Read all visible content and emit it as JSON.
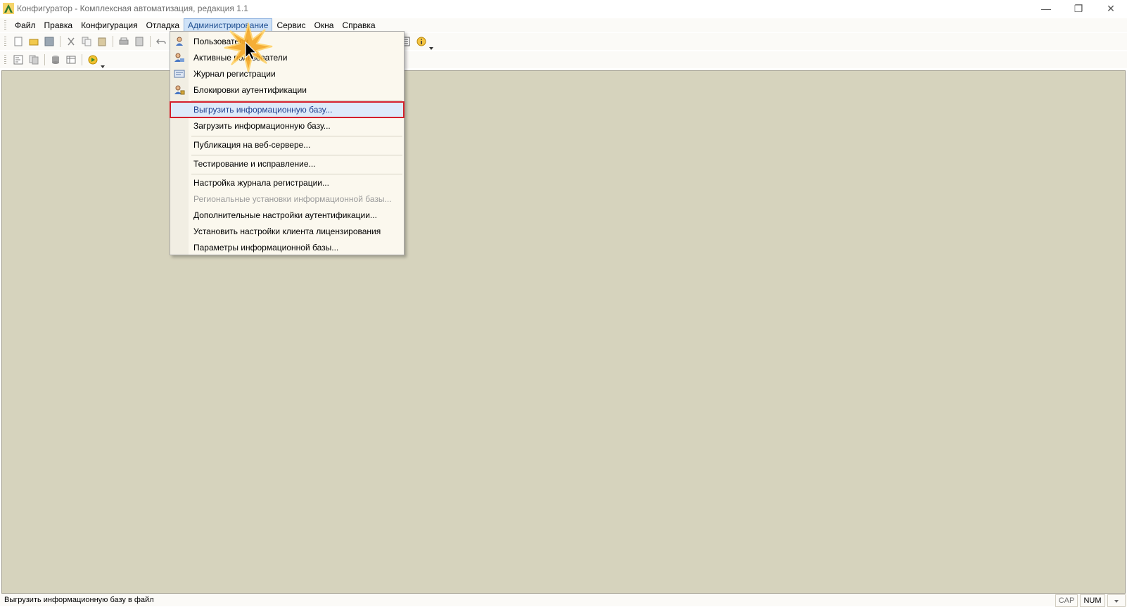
{
  "window": {
    "title": "Конфигуратор - Комплексная автоматизация, редакция 1.1",
    "minimize": "—",
    "restore": "❐",
    "close": "✕"
  },
  "menubar": {
    "items": [
      "Файл",
      "Правка",
      "Конфигурация",
      "Отладка",
      "Администрирование",
      "Сервис",
      "Окна",
      "Справка"
    ],
    "active_index": 4
  },
  "admin_menu": {
    "items": [
      {
        "label": "Пользователи",
        "icon": "user-icon"
      },
      {
        "label": "Активные пользователи",
        "icon": "active-users-icon"
      },
      {
        "label": "Журнал регистрации",
        "icon": "log-icon"
      },
      {
        "label": "Блокировки аутентификации",
        "icon": "lock-user-icon"
      },
      {
        "label": "Выгрузить информационную базу...",
        "highlighted": true
      },
      {
        "label": "Загрузить информационную базу..."
      },
      {
        "label": "Публикация на веб-сервере..."
      },
      {
        "label": "Тестирование и исправление..."
      },
      {
        "label": "Настройка журнала регистрации..."
      },
      {
        "label": "Региональные установки информационной базы...",
        "disabled": true
      },
      {
        "label": "Дополнительные настройки аутентификации..."
      },
      {
        "label": "Установить настройки клиента лицензирования"
      },
      {
        "label": "Параметры информационной базы..."
      }
    ]
  },
  "statusbar": {
    "text": "Выгрузить информационную базу в файл",
    "cap": "CAP",
    "num": "NUM"
  },
  "colors": {
    "workspace": "#d6d3bd",
    "highlight_border": "#d41f2c",
    "menu_bg": "#fbf8ee"
  }
}
